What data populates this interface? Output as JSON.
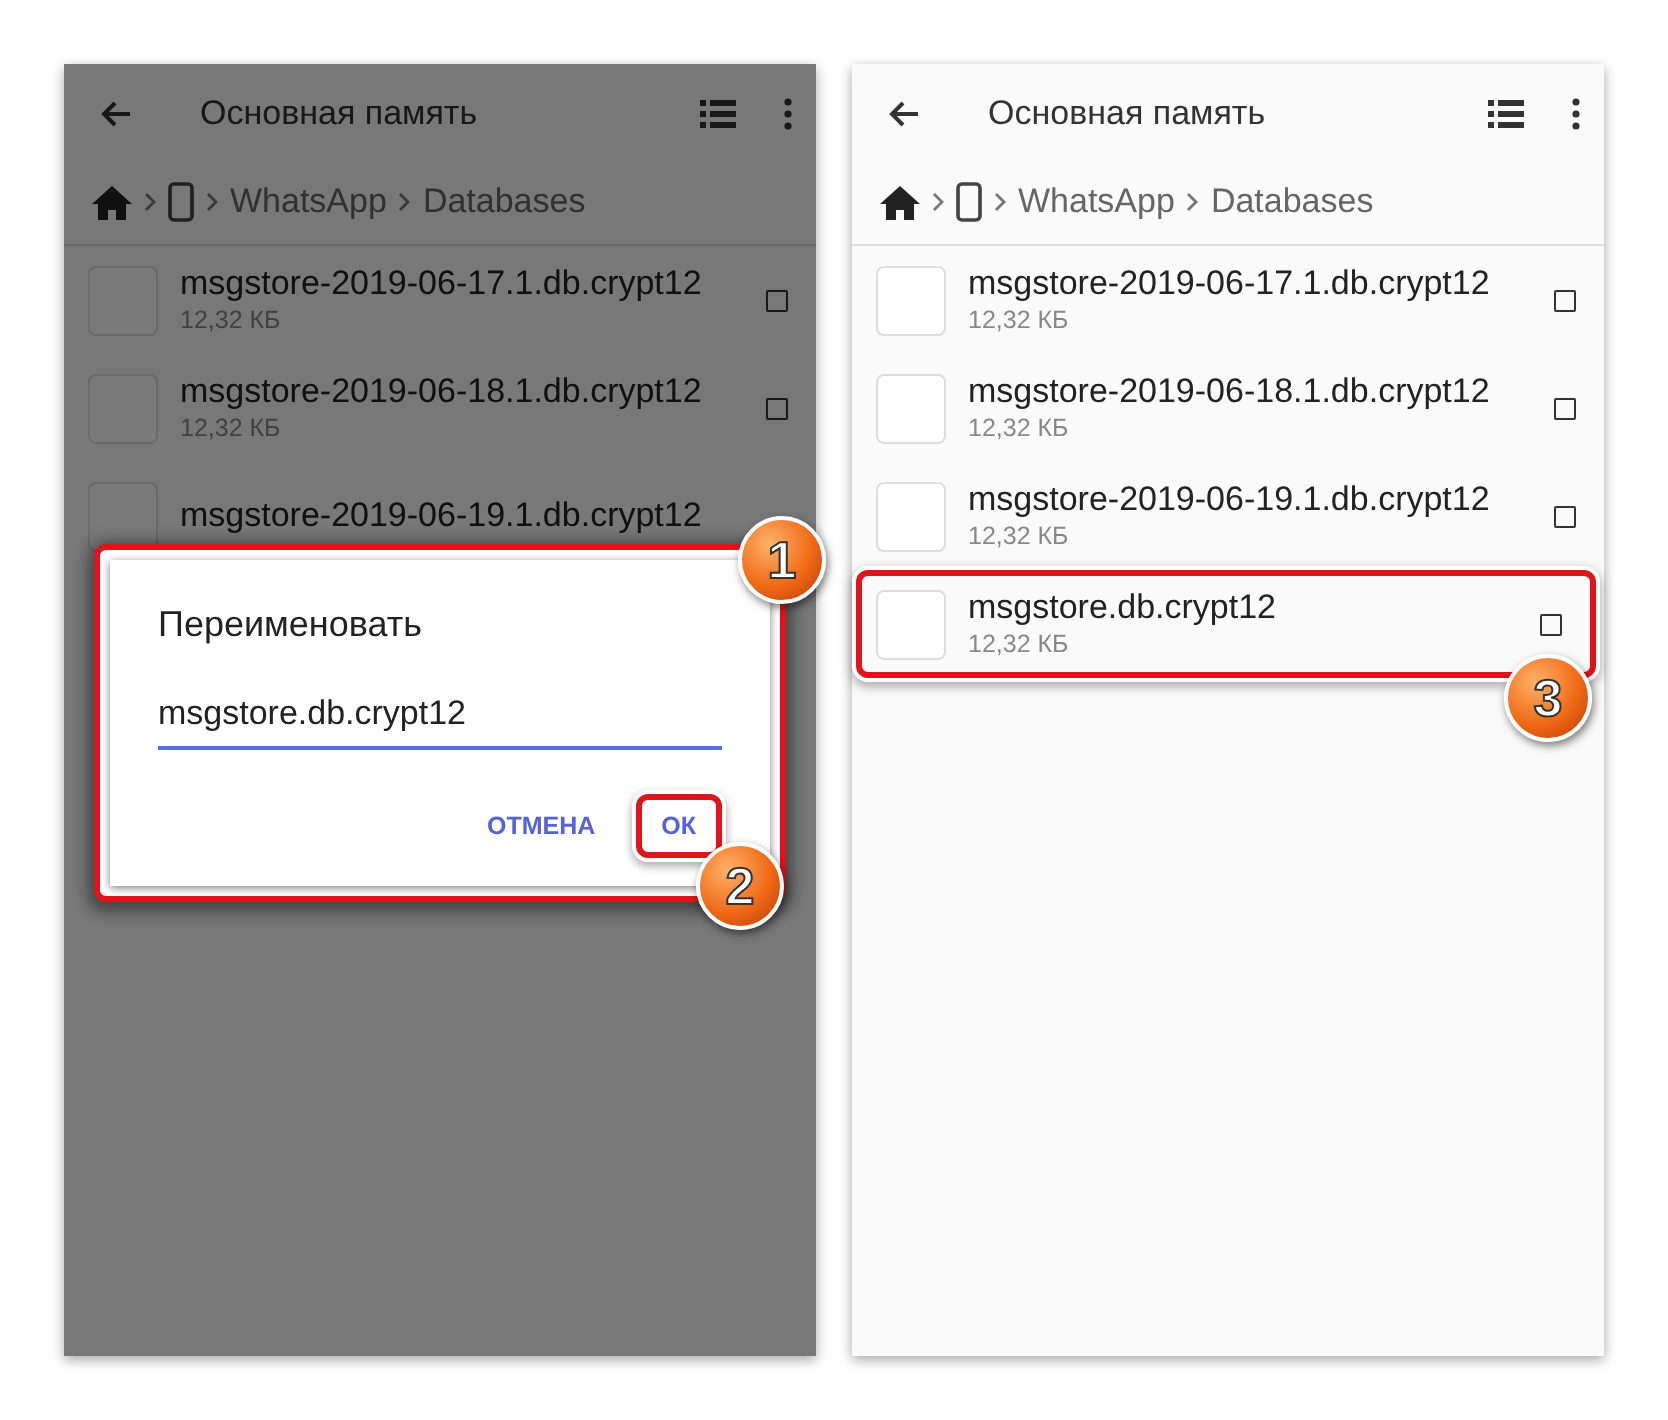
{
  "panels": [
    {
      "dimmed": true,
      "toolbar": {
        "title": "Основная память"
      },
      "breadcrumb": [
        "WhatsApp",
        "Databases"
      ],
      "files": [
        {
          "name": "msgstore-2019-06-17.1.db.crypt12",
          "size": "12,32 КБ",
          "checked": false
        },
        {
          "name": "msgstore-2019-06-18.1.db.crypt12",
          "size": "12,32 КБ",
          "checked": false
        },
        {
          "name": "msgstore-2019-06-19.1.db.crypt12"
        }
      ],
      "dialog": {
        "title": "Переименовать",
        "value": "msgstore.db.crypt12",
        "callout": "1",
        "buttons": [
          {
            "label": "ОТМЕНА",
            "highlighted": false
          },
          {
            "label": "ОК",
            "highlighted": true,
            "callout": "2"
          }
        ]
      }
    },
    {
      "toolbar": {
        "title": "Основная память"
      },
      "breadcrumb": [
        "WhatsApp",
        "Databases"
      ],
      "files": [
        {
          "name": "msgstore-2019-06-17.1.db.crypt12",
          "size": "12,32 КБ",
          "checked": false
        },
        {
          "name": "msgstore-2019-06-18.1.db.crypt12",
          "size": "12,32 КБ",
          "checked": false
        },
        {
          "name": "msgstore-2019-06-19.1.db.crypt12",
          "size": "12,32 КБ",
          "checked": false
        },
        {
          "name": "msgstore.db.crypt12",
          "size": "12,32 КБ",
          "checked": false,
          "highlighted": true,
          "callout": "3"
        }
      ]
    }
  ]
}
